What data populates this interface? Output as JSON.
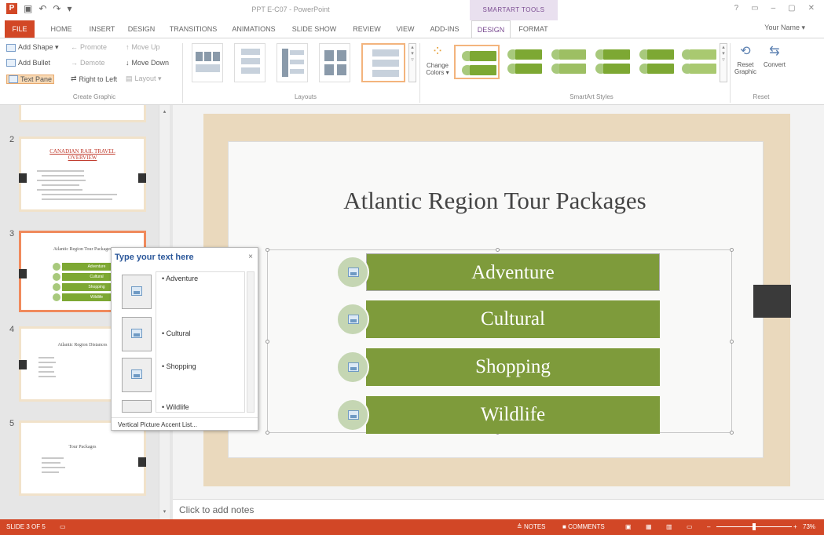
{
  "title_bar": {
    "app_logo": "P",
    "qat_icons": [
      "save-icon",
      "undo-icon",
      "redo-icon",
      "customize-icon"
    ],
    "document_title": "PPT E-C07 - PowerPoint",
    "tools_group_label": "SMARTART TOOLS",
    "window_controls": [
      "?",
      "▭",
      "–",
      "▢",
      "✕"
    ]
  },
  "ribbon_tabs": [
    {
      "label": "FILE"
    },
    {
      "label": "HOME"
    },
    {
      "label": "INSERT"
    },
    {
      "label": "DESIGN"
    },
    {
      "label": "TRANSITIONS"
    },
    {
      "label": "ANIMATIONS"
    },
    {
      "label": "SLIDE SHOW"
    },
    {
      "label": "REVIEW"
    },
    {
      "label": "VIEW"
    },
    {
      "label": "ADD-INS"
    },
    {
      "label": "DESIGN"
    },
    {
      "label": "FORMAT"
    }
  ],
  "user_name": "Your Name ▾",
  "create_graphic": {
    "add_shape": "Add Shape ▾",
    "add_bullet": "Add Bullet",
    "text_pane": "Text Pane",
    "promote": "Promote",
    "demote": "Demote",
    "right_to_left": "Right to Left",
    "move_up": "Move Up",
    "move_down": "Move Down",
    "layout": "Layout ▾",
    "group_label": "Create Graphic"
  },
  "layouts": {
    "group_label": "Layouts"
  },
  "smartart_styles": {
    "change_colors": "Change Colors ▾",
    "group_label": "SmartArt Styles"
  },
  "reset": {
    "reset_graphic": "Reset Graphic",
    "convert": "Convert",
    "group_label": "Reset"
  },
  "slides": [
    {
      "number": "2",
      "title": "CANADIAN RAIL TRAVEL OVERVIEW"
    },
    {
      "number": "3",
      "title": "Atlantic Region Tour Packages",
      "items": [
        "Adventure",
        "Cultural",
        "Shopping",
        "Wildlife"
      ]
    },
    {
      "number": "4",
      "title": "Atlantic Region Distances"
    },
    {
      "number": "5",
      "title": "Tour Packages"
    }
  ],
  "current_slide": {
    "title": "Atlantic Region Tour Packages",
    "items": [
      "Adventure",
      "Cultural",
      "Shopping",
      "Wildlife"
    ]
  },
  "text_pane": {
    "header": "Type your text here",
    "close": "×",
    "items": [
      "Adventure",
      "Cultural",
      "Shopping",
      "Wildlife"
    ],
    "footer": "Vertical Picture Accent List..."
  },
  "notes": {
    "placeholder": "Click to add notes"
  },
  "status_bar": {
    "slide_info": "SLIDE 3 OF 5",
    "notes": "NOTES",
    "comments": "COMMENTS",
    "zoom_minus": "–",
    "zoom_plus": "+",
    "zoom_level": "73%"
  },
  "colors": {
    "brand": "#d24726",
    "smartart_bar": "#7e9b3b",
    "smartart_circle": "#c5d6b3",
    "text_pane_header": "#2b579a"
  }
}
